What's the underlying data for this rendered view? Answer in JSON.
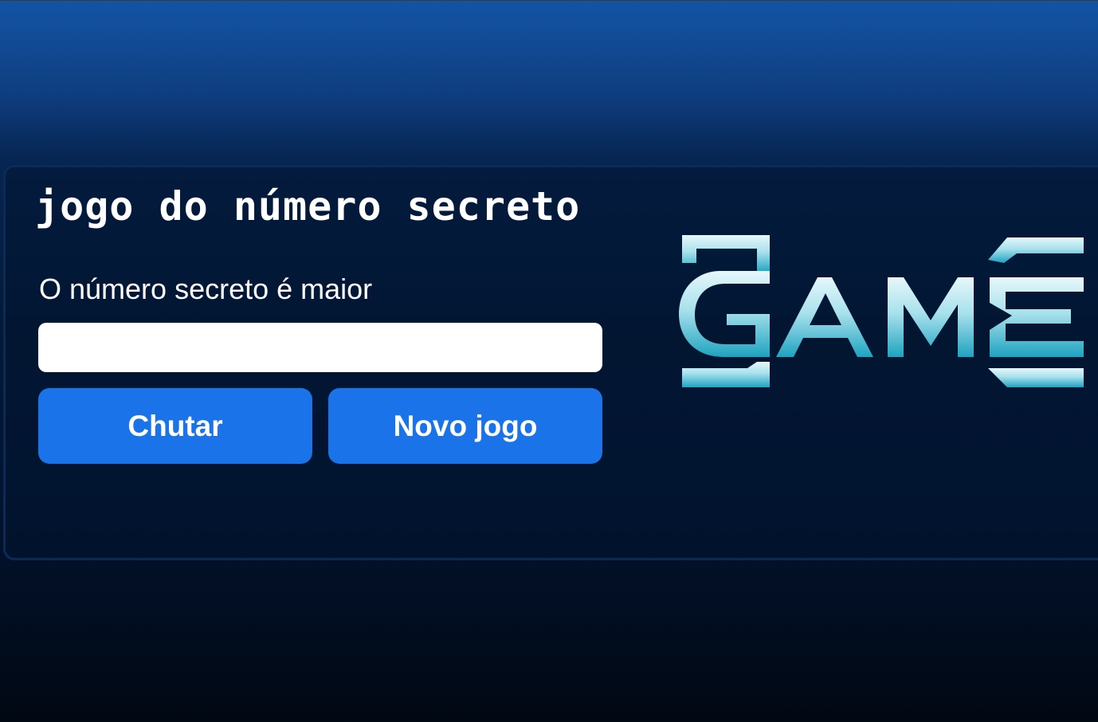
{
  "game": {
    "title": "jogo do número secreto",
    "hint": "O número secreto é maior",
    "input_value": "",
    "guess_button": "Chutar",
    "new_game_button": "Novo jogo"
  },
  "logo": {
    "text": "GAME",
    "colors": {
      "light": "#e6f7fb",
      "mid": "#8fd3e3",
      "dark": "#1ea3c0"
    }
  },
  "theme": {
    "accent": "#1a73e8",
    "background_top": "#1354a5",
    "background_bottom": "#010812"
  }
}
